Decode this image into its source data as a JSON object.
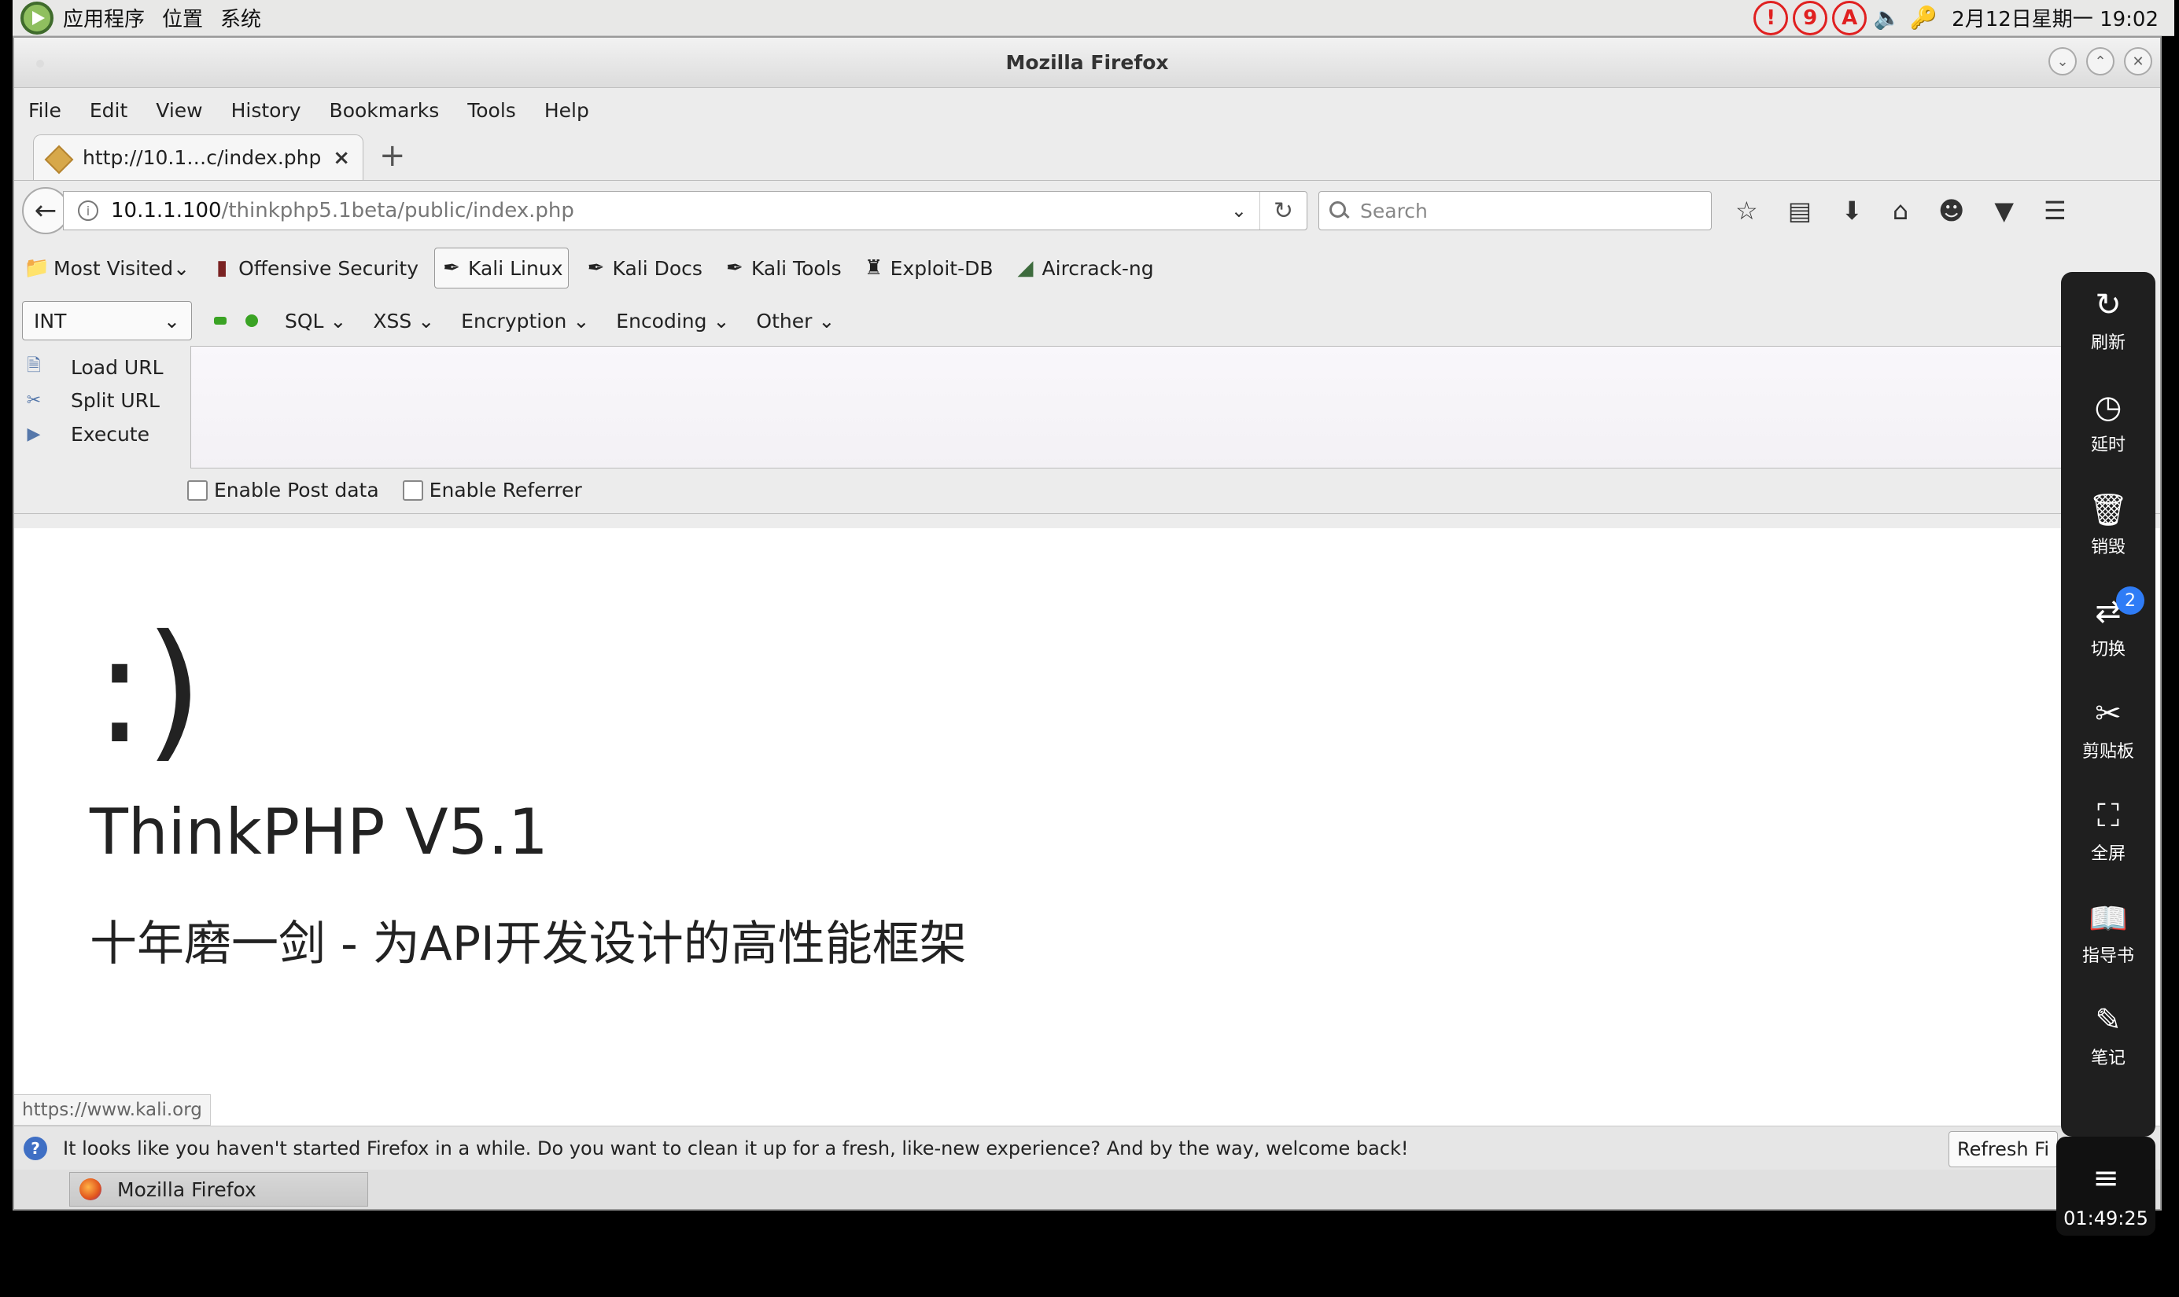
{
  "topbar": {
    "menus": [
      "应用程序",
      "位置",
      "系统"
    ],
    "tray_items": [
      "!",
      "9",
      "A"
    ],
    "clock": "2月12日星期一 19:02"
  },
  "window": {
    "title": "Mozilla Firefox"
  },
  "menubar": [
    "File",
    "Edit",
    "View",
    "History",
    "Bookmarks",
    "Tools",
    "Help"
  ],
  "tab": {
    "label": "http://10.1…c/index.php",
    "close": "×",
    "new_tab": "+"
  },
  "navbar": {
    "url_host": "10.1.1.100",
    "url_path": "/thinkphp5.1beta/public/index.php",
    "search_placeholder": "Search"
  },
  "bookmarks": [
    {
      "label": "Most Visited",
      "icon": "folder-icon"
    },
    {
      "label": "Offensive Security",
      "icon": "offsec-icon"
    },
    {
      "label": "Kali Linux",
      "icon": "kali-dragon-icon"
    },
    {
      "label": "Kali Docs",
      "icon": "kali-dragon-icon"
    },
    {
      "label": "Kali Tools",
      "icon": "kali-dragon-icon"
    },
    {
      "label": "Exploit-DB",
      "icon": "exploitdb-icon"
    },
    {
      "label": "Aircrack-ng",
      "icon": "aircrack-icon"
    }
  ],
  "hackbar": {
    "type_select": "INT",
    "menus": [
      "SQL",
      "XSS",
      "Encryption",
      "Encoding",
      "Other"
    ],
    "actions": [
      "Load URL",
      "Split URL",
      "Execute"
    ],
    "options": [
      "Enable Post data",
      "Enable Referrer"
    ]
  },
  "page": {
    "smile": ":)",
    "title": "ThinkPHP V5.1",
    "subtitle": "十年磨一剑 - 为API开发设计的高性能框架",
    "status_link": "https://www.kali.org"
  },
  "notification": {
    "text": "It looks like you haven't started Firefox in a while. Do you want to clean it up for a fresh, like-new experience? And by the way, welcome back!",
    "button": "Refresh Fi"
  },
  "taskbar": {
    "app": "Mozilla Firefox"
  },
  "sidebar": {
    "items": [
      {
        "label": "刷新",
        "icon": "refresh-icon"
      },
      {
        "label": "延时",
        "icon": "clock-icon"
      },
      {
        "label": "销毁",
        "icon": "trash-icon"
      },
      {
        "label": "切换",
        "icon": "switch-icon",
        "badge": "2"
      },
      {
        "label": "剪贴板",
        "icon": "scissors-icon"
      },
      {
        "label": "全屏",
        "icon": "fullscreen-icon"
      },
      {
        "label": "指导书",
        "icon": "book-icon"
      },
      {
        "label": "笔记",
        "icon": "pen-icon"
      }
    ],
    "timer": "01:49:25"
  },
  "colors": {
    "tray_alert": "#e02020",
    "sidebar_bg": "#1f1f1f",
    "badge": "#2f7cf6"
  }
}
